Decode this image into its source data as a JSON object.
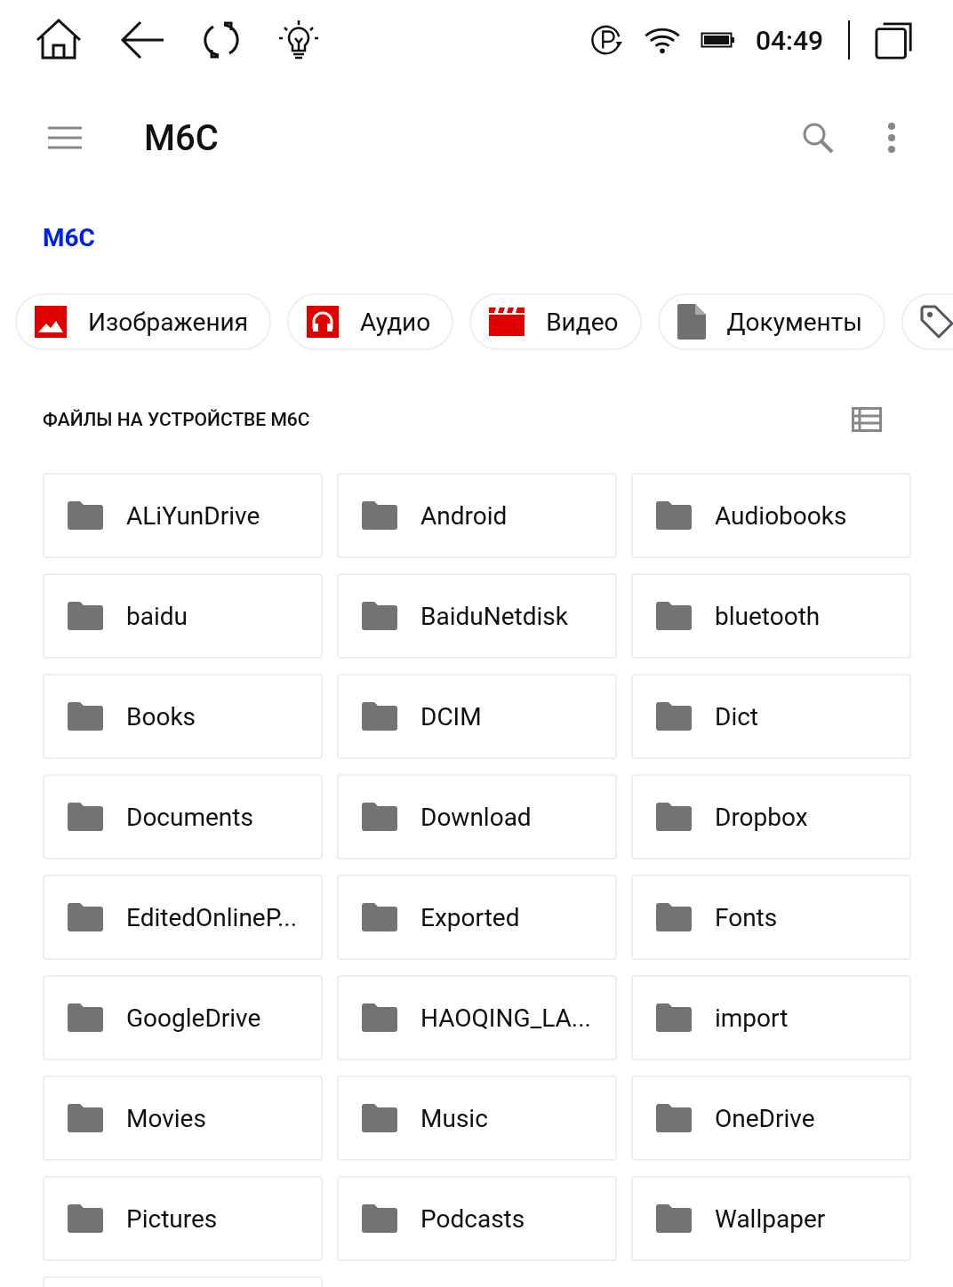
{
  "status_bar": {
    "time": "04:49"
  },
  "toolbar": {
    "title": "M6C"
  },
  "breadcrumb": "M6C",
  "categories": [
    {
      "kind": "images",
      "label": "Изображения"
    },
    {
      "kind": "audio",
      "label": "Аудио"
    },
    {
      "kind": "video",
      "label": "Видео"
    },
    {
      "kind": "documents",
      "label": "Документы"
    },
    {
      "kind": "tags"
    }
  ],
  "section": {
    "title": "ФАЙЛЫ НА УСТРОЙСТВЕ M6C"
  },
  "folders": [
    {
      "name": "ALiYunDrive"
    },
    {
      "name": "Android"
    },
    {
      "name": "Audiobooks"
    },
    {
      "name": "baidu"
    },
    {
      "name": "BaiduNetdisk"
    },
    {
      "name": "bluetooth"
    },
    {
      "name": "Books"
    },
    {
      "name": "DCIM"
    },
    {
      "name": "Dict"
    },
    {
      "name": "Documents"
    },
    {
      "name": "Download"
    },
    {
      "name": "Dropbox"
    },
    {
      "name": "EditedOnlineP..."
    },
    {
      "name": "Exported"
    },
    {
      "name": "Fonts"
    },
    {
      "name": "GoogleDrive"
    },
    {
      "name": "HAOQING_LA..."
    },
    {
      "name": "import"
    },
    {
      "name": "Movies"
    },
    {
      "name": "Music"
    },
    {
      "name": "OneDrive"
    },
    {
      "name": "Pictures"
    },
    {
      "name": "Podcasts"
    },
    {
      "name": "Wallpaper"
    },
    {
      "kind": "partial"
    }
  ]
}
